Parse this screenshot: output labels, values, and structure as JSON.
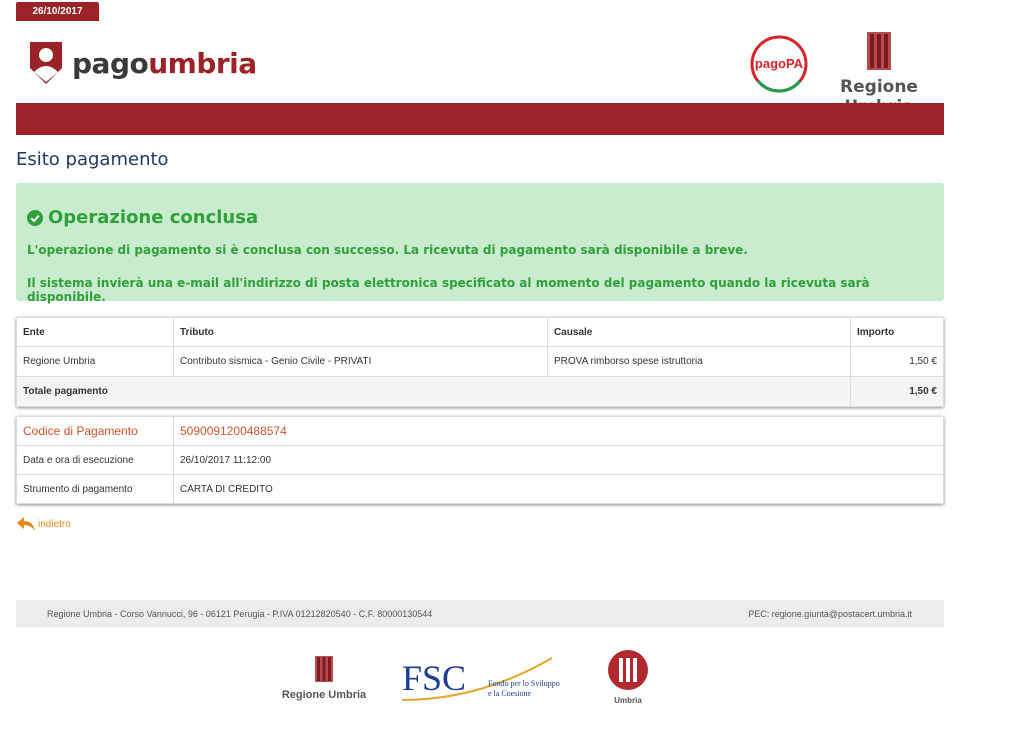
{
  "header": {
    "date": "26/10/2017",
    "logo_prefix": "pago",
    "logo_suffix": "umbria",
    "pagopa_logo": "pagoPA",
    "regione_label": "Regione Umbria"
  },
  "page_title": "Esito pagamento",
  "alert": {
    "icon": "check-circle-icon",
    "title": "Operazione conclusa",
    "line1": "L'operazione di pagamento si è conclusa con successo. La ricevuta di pagamento sarà disponibile a breve.",
    "line2": "Il sistema invierà una e-mail all'indirizzo di posta elettronica specificato al momento del pagamento quando la ricevuta sarà disponibile.",
    "colors": {
      "background": "#c9ecce",
      "text": "#30a03a"
    }
  },
  "payment_table": {
    "headers": [
      "Ente",
      "Tributo",
      "Causale",
      "Importo"
    ],
    "rows": [
      [
        "Regione Umbria",
        "Contributo sismica - Genio Civile - PRIVATI",
        "PROVA rimborso spese istruttoria",
        "1,50 €"
      ]
    ],
    "total_label": "Totale pagamento",
    "total_value": "1,50 €"
  },
  "details": [
    {
      "label": "Codice di Pagamento",
      "value": "5090091200488574"
    },
    {
      "label": "Data e ora di esecuzione",
      "value": "26/10/2017 11:12:00"
    },
    {
      "label": "Strumento di pagamento",
      "value": "CARTA DI CREDITO"
    }
  ],
  "back_link": "indietro",
  "footer": {
    "address": "Regione Umbria - Corso Vannucci, 96 - 06121 Perugia - P.IVA 01212820540 - C.F. 80000130544",
    "pec": "PEC: regione.giunta@postacert.umbria.it",
    "logo1": "Regione Umbria",
    "logo2_main": "FSC",
    "logo2_sub1": "Fondo per lo Sviluppo",
    "logo2_sub2": "e la Coesione",
    "logo3": "Umbria"
  },
  "colors": {
    "brand": "#9b2226",
    "title": "#1f3a60",
    "accent_orange": "#e8891e",
    "code": "#d15428"
  }
}
